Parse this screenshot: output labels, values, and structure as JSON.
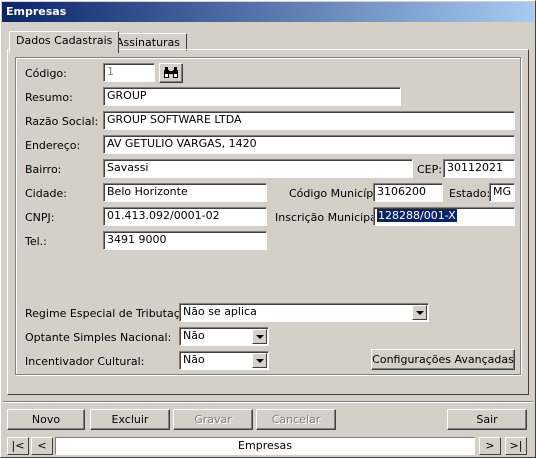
{
  "window": {
    "title": "Empresas"
  },
  "tabs": [
    "Dados Cadastrais",
    "Assinaturas"
  ],
  "form": {
    "codigo": {
      "label": "Código:",
      "value": "1"
    },
    "resumo": {
      "label": "Resumo:",
      "value": "GROUP"
    },
    "razao_social": {
      "label": "Razão Social:",
      "value": "GROUP SOFTWARE LTDA"
    },
    "endereco": {
      "label": "Endereço:",
      "value": "AV GETULIO VARGAS, 1420"
    },
    "bairro": {
      "label": "Bairro:",
      "value": "Savassi"
    },
    "cep": {
      "label": "CEP:",
      "value": "30112021"
    },
    "cidade": {
      "label": "Cidade:",
      "value": "Belo Horizonte"
    },
    "codigo_municipio": {
      "label": "Código Município:",
      "value": "3106200"
    },
    "estado": {
      "label": "Estado:",
      "value": "MG"
    },
    "cnpj": {
      "label": "CNPJ:",
      "value": "01.413.092/0001-02"
    },
    "inscricao_municipal": {
      "label": "Inscrição Municipal:",
      "value": "128288/001-X"
    },
    "tel": {
      "label": "Tel.:",
      "value": "3491 9000"
    },
    "regime": {
      "label": "Regime Especial de Tributação:",
      "value": "Não se aplica"
    },
    "simples": {
      "label": "Optante Simples Nacional:",
      "value": "Não"
    },
    "incentivador": {
      "label": "Incentivador Cultural:",
      "value": "Não"
    },
    "config_button": "Configurações Avançadas"
  },
  "toolbar": {
    "novo": "Novo",
    "excluir": "Excluir",
    "gravar": "Gravar",
    "cancelar": "Cancelar",
    "sair": "Sair"
  },
  "navigator": {
    "first": "|<",
    "prev": "<",
    "label": "Empresas",
    "next": ">",
    "last": ">|"
  },
  "colors": {
    "titlebar": "#0a246a",
    "selection": "#0a246a",
    "face": "#d4d0c8"
  }
}
